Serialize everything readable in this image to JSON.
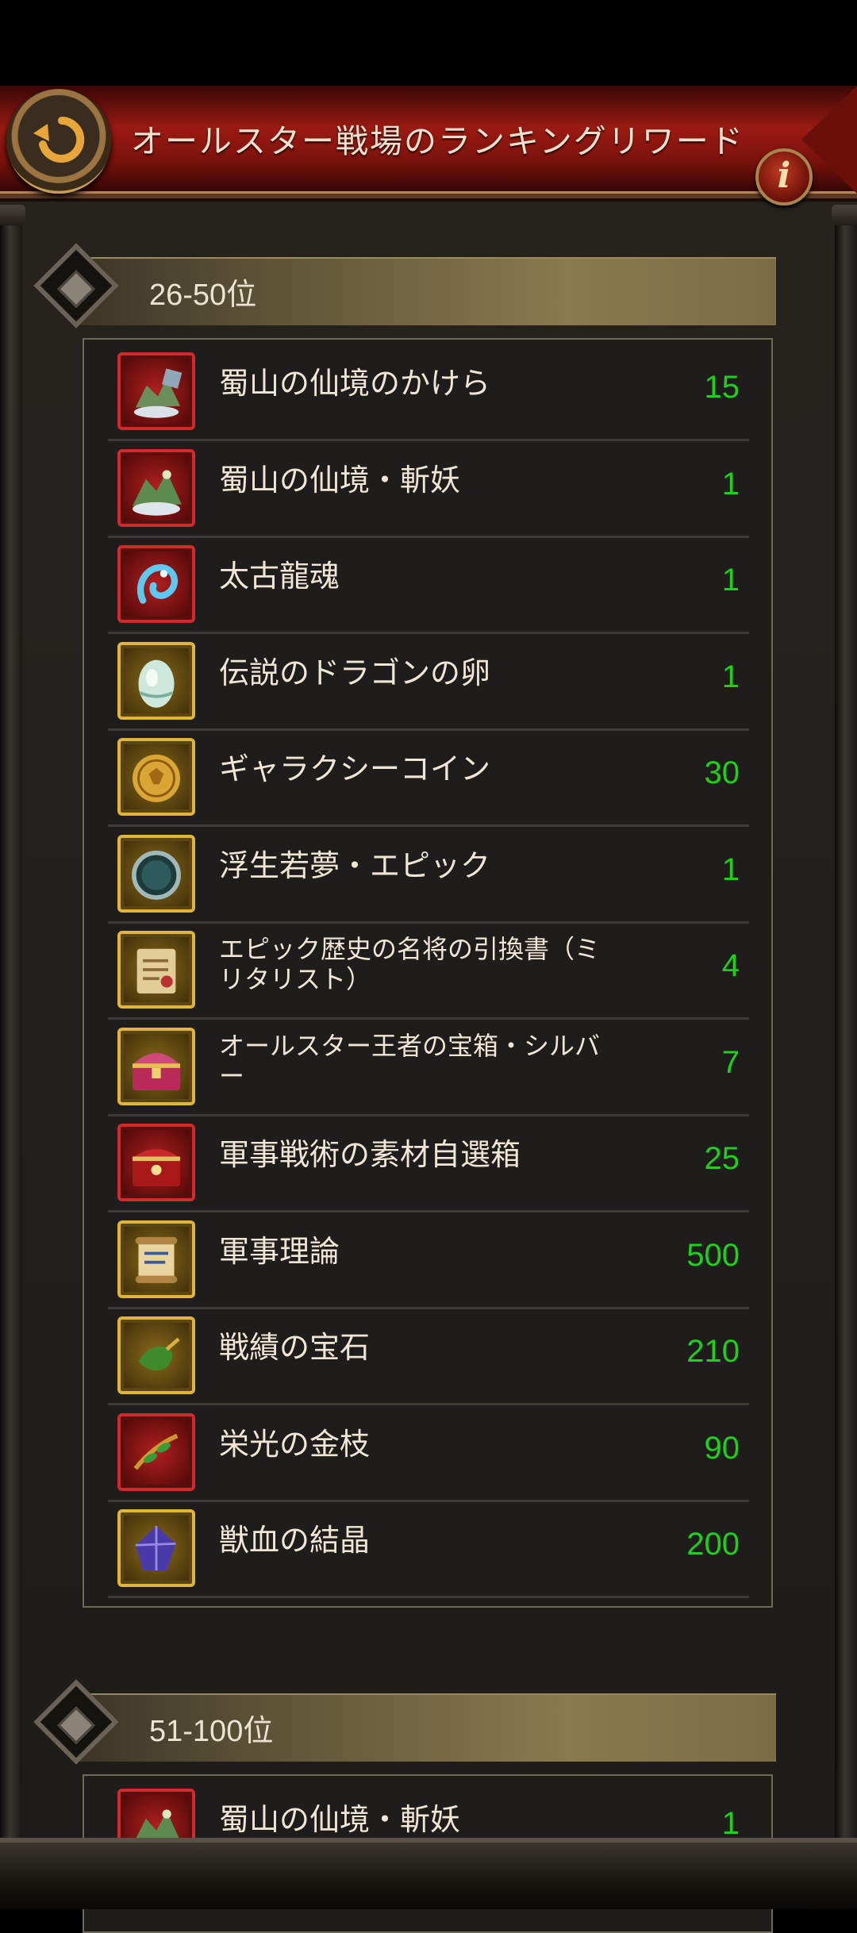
{
  "header": {
    "title": "オールスター戦場のランキングリワード"
  },
  "sections": [
    {
      "label": "26-50位",
      "items": [
        {
          "name": "蜀山の仙境のかけら",
          "qty": "15",
          "frame": "red",
          "icon": "fairyland-fragment-icon"
        },
        {
          "name": "蜀山の仙境・斬妖",
          "qty": "1",
          "frame": "red",
          "icon": "fairyland-demon-slayer-icon"
        },
        {
          "name": "太古龍魂",
          "qty": "1",
          "frame": "red",
          "icon": "ancient-dragon-soul-icon"
        },
        {
          "name": "伝説のドラゴンの卵",
          "qty": "1",
          "frame": "gold",
          "icon": "dragon-egg-icon"
        },
        {
          "name": "ギャラクシーコイン",
          "qty": "30",
          "frame": "gold",
          "icon": "galaxy-coin-icon"
        },
        {
          "name": "浮生若夢・エピック",
          "qty": "1",
          "frame": "gold",
          "icon": "dream-mirror-icon"
        },
        {
          "name": "エピック歴史の名将の引換書（ミリタリスト）",
          "qty": "4",
          "frame": "gold",
          "icon": "exchange-scroll-icon"
        },
        {
          "name": "オールスター王者の宝箱・シルバー",
          "qty": "7",
          "frame": "gold",
          "icon": "treasure-chest-icon"
        },
        {
          "name": "軍事戦術の素材自選箱",
          "qty": "25",
          "frame": "red",
          "icon": "material-box-icon"
        },
        {
          "name": "軍事理論",
          "qty": "500",
          "frame": "gold",
          "icon": "military-theory-scroll-icon"
        },
        {
          "name": "戦績の宝石",
          "qty": "210",
          "frame": "gold",
          "icon": "merit-gem-icon"
        },
        {
          "name": "栄光の金枝",
          "qty": "90",
          "frame": "red",
          "icon": "golden-branch-icon"
        },
        {
          "name": "獣血の結晶",
          "qty": "200",
          "frame": "gold",
          "icon": "beast-blood-crystal-icon"
        }
      ]
    },
    {
      "label": "51-100位",
      "items": [
        {
          "name": "蜀山の仙境・斬妖",
          "qty": "1",
          "frame": "red",
          "icon": "fairyland-demon-slayer-icon"
        }
      ]
    }
  ],
  "info_button": {
    "glyph": "i"
  }
}
